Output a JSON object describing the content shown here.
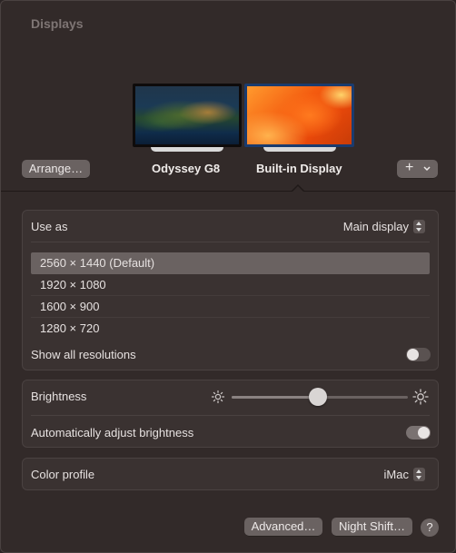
{
  "window": {
    "title": "Displays"
  },
  "displays": [
    {
      "name": "Odyssey G8",
      "wallpaper": "big-sur-coastline"
    },
    {
      "name": "Built-in Display",
      "wallpaper": "ventura-orange",
      "selected": true
    }
  ],
  "toolbar": {
    "arrange_label": "Arrange…",
    "add_symbol": "+",
    "add_chevron": "⌄"
  },
  "use_as": {
    "label": "Use as",
    "value": "Main display"
  },
  "resolutions": {
    "items": [
      "2560 × 1440 (Default)",
      "1920 × 1080",
      "1600 × 900",
      "1280 × 720"
    ],
    "selected_index": 0,
    "show_all_label": "Show all resolutions",
    "show_all_enabled": false
  },
  "brightness": {
    "label": "Brightness",
    "level": 0.49,
    "auto_label": "Automatically adjust brightness",
    "auto_enabled": true
  },
  "color_profile": {
    "label": "Color profile",
    "value": "iMac"
  },
  "footer": {
    "advanced_label": "Advanced…",
    "night_shift_label": "Night Shift…",
    "help_label": "?"
  },
  "colors": {
    "panel": "#322a29",
    "group": "#3a3231",
    "button": "#6a6261",
    "text": "#e6e1e0"
  }
}
